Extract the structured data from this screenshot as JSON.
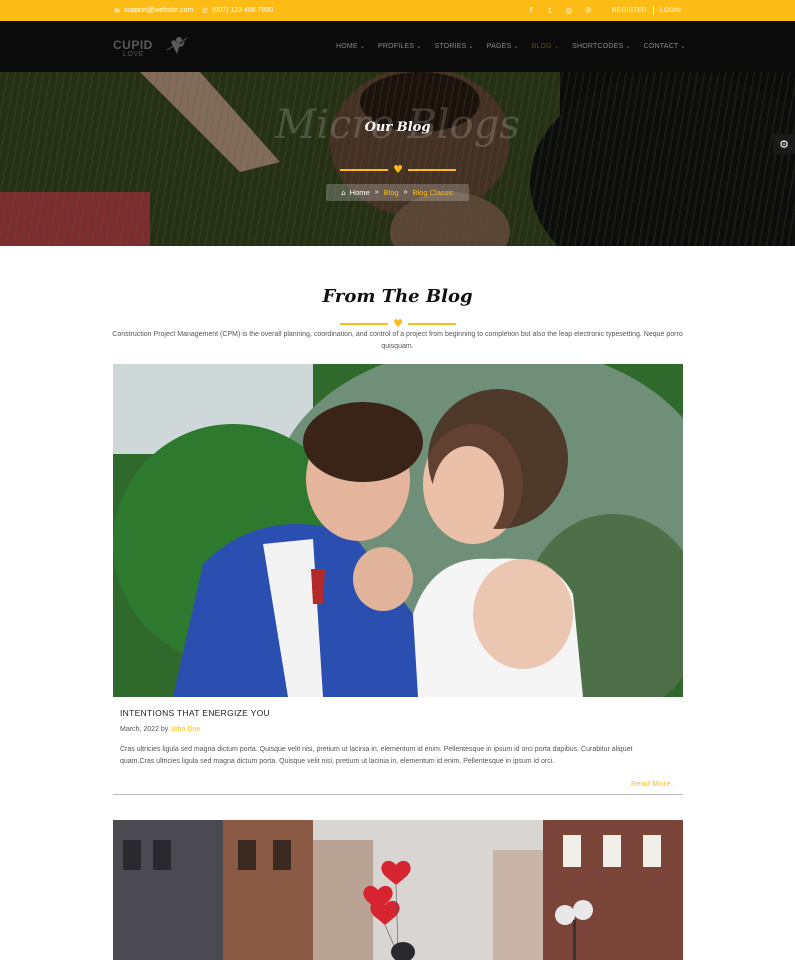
{
  "topbar": {
    "email": "support@website.com",
    "phone": "(007) 123 456 7890",
    "social": [
      {
        "icon": "facebook-icon",
        "glyph": "f"
      },
      {
        "icon": "twitter-icon",
        "glyph": "t"
      },
      {
        "icon": "instagram-icon",
        "glyph": "◎"
      },
      {
        "icon": "pinterest-icon",
        "glyph": "℗"
      }
    ],
    "register_label": "REGISTER",
    "login_label": "LOGIN"
  },
  "navbar": {
    "logo_main": "CUPID",
    "logo_sub": "LOVE",
    "menu": [
      {
        "label": "HOME",
        "active": false
      },
      {
        "label": "PROFILES",
        "active": false
      },
      {
        "label": "STORIES",
        "active": false
      },
      {
        "label": "PAGES",
        "active": false
      },
      {
        "label": "BLOG",
        "active": true
      },
      {
        "label": "SHORTCODES",
        "active": false
      },
      {
        "label": "CONTACT",
        "active": false
      }
    ]
  },
  "hero": {
    "bg_text": "Micro Blogs",
    "title": "Our Blog",
    "breadcrumb": {
      "home": "Home",
      "blog": "Blog",
      "current": "Blog Classic"
    }
  },
  "section": {
    "title": "From The Blog",
    "description": "Construction Project Management (CPM) is the overall planning, coordination, and control of a project from beginning to completion but also the leap electronic typesetting. Neque porro quisquam."
  },
  "post": {
    "title": "INTENTIONS THAT ENERGIZE YOU",
    "date": "March, 2022 by",
    "author": "John Doe",
    "excerpt": "Cras ultricies ligula sed magna dictum porta. Quisque velit nisi, pretium ut lacinia in, elementum id enim. Pellentesque in ipsum id orci porta dapibus. Curabitur aliquet quam.Cras ultricies ligula sed magna dictum porta. Quisque velit nisi, pretium ut lacinia in, elementum id enim. Pellentesque in ipsum id orci.",
    "read_more": "Read More.."
  },
  "colors": {
    "accent": "#fdbb15",
    "navbar_bg": "#0b0b0b",
    "text": "#555555"
  }
}
